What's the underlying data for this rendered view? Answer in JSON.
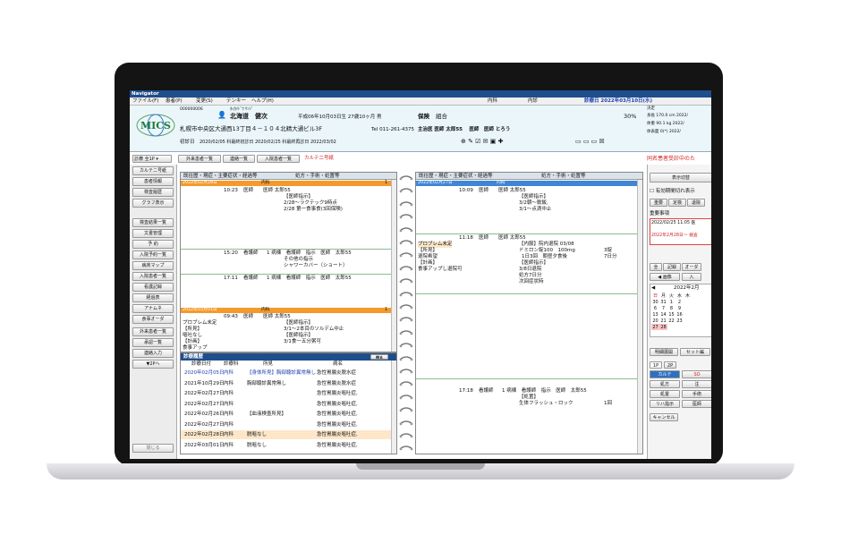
{
  "window": {
    "title": "Navigator"
  },
  "menu": [
    "ファイル(F)",
    "患者(P)",
    "変更(S)",
    "テンキー",
    "ヘルプ(H)"
  ],
  "menu_right": {
    "dept": "内科",
    "clinic": "内診",
    "visit_date": "診療日 2022年03月10日(水)"
  },
  "patient": {
    "id": "000000006",
    "kana": "ﾎｯｶｲﾄﾞｳ ｹﾝｼﾞ",
    "name": "北海道　健次",
    "birth": "平成06年10月03日生 27歳10ヶ月 男",
    "address": "札幌市中央区大通西13丁目４－１０４北精大通ビル3F",
    "tel": "Tel 011-261-4375",
    "first_visit_label": "初診日",
    "first_visit": "2020/02/05 科最終初診日 2020/02/25 科最終再診日 2022/03/02"
  },
  "insurance": {
    "label": "保険",
    "type": "組合",
    "ratio": "30%",
    "doctors": "主治医 医師 太郎55　 医師　医師 とろう"
  },
  "vitals": {
    "height": "身長 170.0 cm 2022/",
    "weight": "体重 90.1 kg 2022/",
    "bmi": "体表面 0(*) 2022/",
    "decide": "決定"
  },
  "colors": {
    "title": "#1f4e8c",
    "header": "#eaf6fa",
    "orange": "#f39a2b",
    "blue": "#3f86d6",
    "red": "#d21f1f"
  },
  "tabs": {
    "dept_select": "診療 全1P",
    "outpatient": "外来患者一覧",
    "contact": "連絡一覧",
    "inpatient": "入院患者一覧",
    "karte_memo": "カルテ二号紙",
    "duplicate": "同名患者受診中のた"
  },
  "side": [
    "カルテ二号紙",
    "患者情報",
    "検査履歴",
    "グラフ表示",
    "検査結果一覧",
    "文書管理",
    "予 約",
    "入院予約一覧",
    "病床マップ",
    "入院患者一覧",
    "看護記録",
    "経過表",
    "アナムネ",
    "食事オーダ",
    "外来患者一覧",
    "承認一覧",
    "連絡入力",
    "▼2Pへ"
  ],
  "side_bottom": "閉じる",
  "panel_header": {
    "c1": "既往歴・現症・主要症状・経過等",
    "c2": "処方・手術・処置等"
  },
  "left_panel": {
    "date1": "2022年02月28日",
    "dept1": "内科",
    "p1": "1",
    "e1_time": "10:23",
    "e1_role": "医師",
    "e1_who": "医師 太郎55",
    "e1_tag": "【医師指示】",
    "e1_l1": "2/28～ラクテック9時点",
    "e1_l2": "2/28 第一食事食(3回保険)",
    "e2_time": "15:20",
    "e2_role": "看護師",
    "e2_info": "1 病棟　看護師　指示　医師　太郎55",
    "e2_l1": "その他の指示",
    "e2_l2": "シャワーカバー（ショート）",
    "e3_time": "17:11",
    "e3_role": "看護師",
    "e3_info": "1 病棟　看護師　指示　医師　太郎55",
    "date2": "2022年03月01日",
    "dept2": "内科",
    "p2": "1",
    "e4_time": "09:43",
    "e4_role": "医師",
    "e4_who": "医師 太郎55",
    "e4_a1": "プロブレム未定",
    "e4_a2": "【所見】",
    "e4_a3": "嘔吐なし",
    "e4_a4": "【計画】",
    "e4_a5": "食事アップ",
    "e4_b1": "【医師指示】",
    "e4_b2": "3/1～2本目のソルデム中止",
    "e4_b3": "【医師指示】",
    "e4_b4": "3/1食一五分粥可"
  },
  "history": {
    "title": "診療履歴",
    "button": "閉る",
    "cols": [
      "診療日付",
      "診療科",
      "所見",
      "病名"
    ],
    "rows": [
      {
        "date": "2020年02月05日",
        "dept": "内科",
        "finding": "【身体所見】胸部聴診異常無し",
        "disease": "急性胃腸炎脱水症",
        "blue": true,
        "hl": false
      },
      {
        "date": "2021年10月29日",
        "dept": "内科",
        "finding": "胸部聴診異常無し",
        "disease": "急性胃腸炎脱水症",
        "blue": false,
        "hl": false
      },
      {
        "date": "2022年02月27日",
        "dept": "内科",
        "finding": "",
        "disease": "急性胃腸炎嘔吐症,",
        "blue": false,
        "hl": false
      },
      {
        "date": "2022年02月27日",
        "dept": "内科",
        "finding": "",
        "disease": "急性胃腸炎嘔吐症,",
        "blue": false,
        "hl": false
      },
      {
        "date": "2022年02月26日",
        "dept": "内科",
        "finding": "【血液検査所見】",
        "disease": "急性胃腸炎嘔吐症,",
        "blue": false,
        "hl": false
      },
      {
        "date": "2022年02月27日",
        "dept": "内科",
        "finding": "",
        "disease": "急性胃腸炎嘔吐症,",
        "blue": false,
        "hl": false
      },
      {
        "date": "2022年02月28日",
        "dept": "内科",
        "finding": "脱嘔なし",
        "disease": "急性胃腸炎嘔吐症,",
        "blue": false,
        "hl": true
      },
      {
        "date": "2022年03月01日",
        "dept": "内科",
        "finding": "脱嘔なし",
        "disease": "急性胃腸炎嘔吐症,",
        "blue": false,
        "hl": false
      }
    ]
  },
  "right_panel": {
    "date1": "2022年02月27日",
    "dept1": "内科",
    "e1_time": "10:09",
    "e1_role": "医師",
    "e1_who": "医師 太郎55",
    "e1_l1": "【医師指示】",
    "e1_l2": "3/2朝～軟飯,",
    "e1_l3": "3/1～点滴中止",
    "e2_time": "11:18",
    "e2_role": "医師",
    "e2_who": "医師 太郎55",
    "e2_a1": "プロブレム未定",
    "e2_a2": "【所見】",
    "e2_a3": "退院希望",
    "e2_a4": "【計画】",
    "e2_a5": "食事アップし退院可",
    "e2_b1": "【内服】院内退院 03/08",
    "e2_b2": "ドミロン錠100　100mg",
    "e2_b3": "1日3回　朝昼夕食後",
    "e2_b4": "【医師指示】",
    "e2_b5": "3/8日退院",
    "e2_b6": "処方7日分",
    "e2_b7": "次回症状時",
    "e2_c1": "3錠",
    "e2_c2": "7日分",
    "e3_time": "17:18",
    "e3_role": "看護師",
    "e3_info": "1 病棟　看護師　指示　医師　太郎55",
    "e3_l1": "【処置】",
    "e3_l2": "生体フラッシュ・ロック",
    "e3_c": "1回"
  },
  "far_right": {
    "view_switch": "表示切替",
    "expiry": "有効期間切れ表示",
    "tabs": [
      "重要",
      "定検",
      "退院"
    ],
    "important": "重要事項",
    "n1_date": "2022/02/25 11:05 医",
    "n2": "2022年2月28日～ 検査",
    "filters": [
      "全",
      "記録",
      "オーダ"
    ],
    "sub": [
      "画像",
      "入"
    ],
    "cal_title": "2022年2月",
    "cal_head": [
      "日",
      "月",
      "火",
      "水",
      "木"
    ],
    "cal": [
      [
        "30",
        "31",
        "1",
        "2"
      ],
      [
        "6",
        "7",
        "8",
        "9"
      ],
      [
        "13",
        "14",
        "15",
        "16"
      ],
      [
        "20",
        "21",
        "22",
        "23"
      ],
      [
        "27",
        "28"
      ]
    ],
    "btn_detail": "明細展開",
    "btn_set": "セット編",
    "pg": [
      "1P",
      "2P"
    ],
    "ord": [
      [
        "カルテ",
        "SO"
      ],
      [
        "処方",
        "注"
      ],
      [
        "処置",
        "手術"
      ],
      [
        "リハ指示",
        "医師"
      ]
    ],
    "cancel": "キャンセル"
  }
}
